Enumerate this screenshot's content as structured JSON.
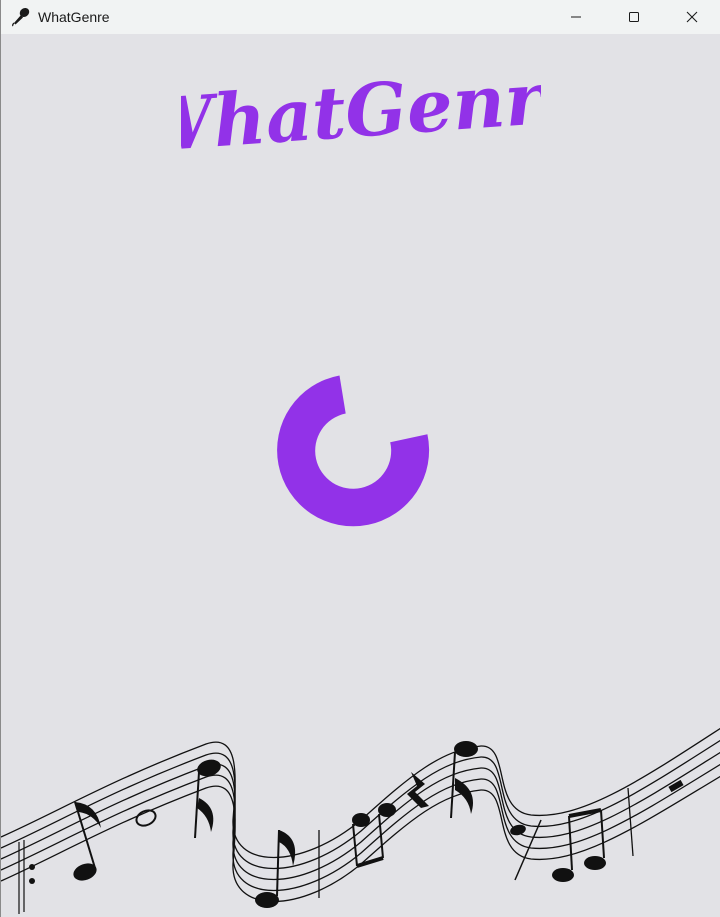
{
  "window": {
    "title": "WhatGenre",
    "app_icon": "microphone-icon",
    "controls": [
      "minimize-icon",
      "maximize-icon",
      "close-icon"
    ]
  },
  "logo": {
    "text": "WhatGenre",
    "color": "#9232e8"
  },
  "spinner": {
    "color": "#9232e8",
    "state": "loading"
  },
  "decoration": {
    "name": "music-staff-illustration"
  }
}
